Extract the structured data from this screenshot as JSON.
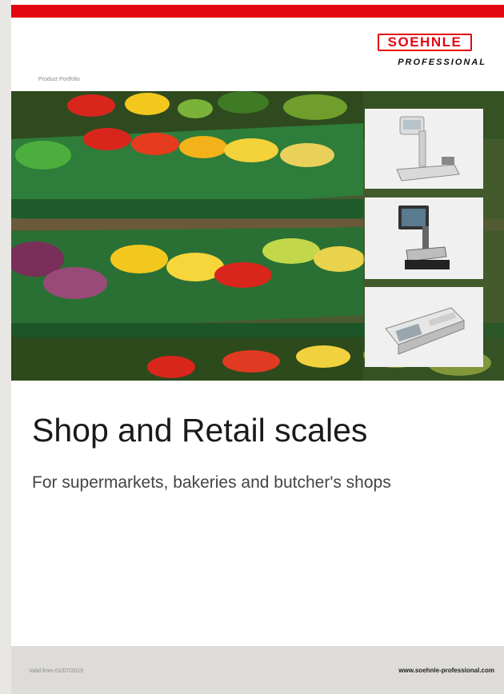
{
  "brand": {
    "name": "SOEHNLE",
    "sub": "PROFESSIONAL",
    "color": "#e30613"
  },
  "header": {
    "portfolio_label": "Product Portfolio"
  },
  "hero": {
    "description_icons": [
      "produce-shelf-photo",
      "scale-thumbnail",
      "scale-thumbnail",
      "scale-thumbnail"
    ]
  },
  "cover": {
    "title": "Shop and Retail scales",
    "subtitle": "For supermarkets, bakeries and butcher's shops"
  },
  "footer": {
    "valid_from": "Valid from 01/07/2019",
    "website": "www.soehnle-professional.com"
  }
}
